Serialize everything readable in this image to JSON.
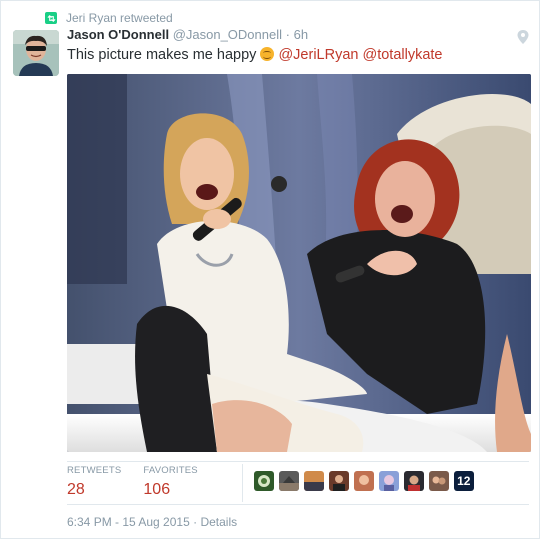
{
  "retweet_banner": {
    "text": "Jeri Ryan retweeted",
    "icon": "retweet-icon",
    "accent": "#19cf86"
  },
  "tweet": {
    "author_name": "Jason O'Donnell",
    "author_handle": "@Jason_ODonnell",
    "separator": "·",
    "time_ago": "6h",
    "text": "This picture makes me happy",
    "emoji": "smiling-face-icon",
    "mentions": [
      "@JeriLRyan",
      "@totallykate"
    ],
    "mention_color": "#c0392b"
  },
  "stats": {
    "retweets_label": "RETWEETS",
    "retweets_value": "28",
    "favorites_label": "FAVORITES",
    "favorites_value": "106",
    "favoriter_avatars": 9,
    "last_avatar_text": "12"
  },
  "footer": {
    "timestamp": "6:34 PM - 15 Aug 2015",
    "separator": "·",
    "details_label": "Details"
  }
}
